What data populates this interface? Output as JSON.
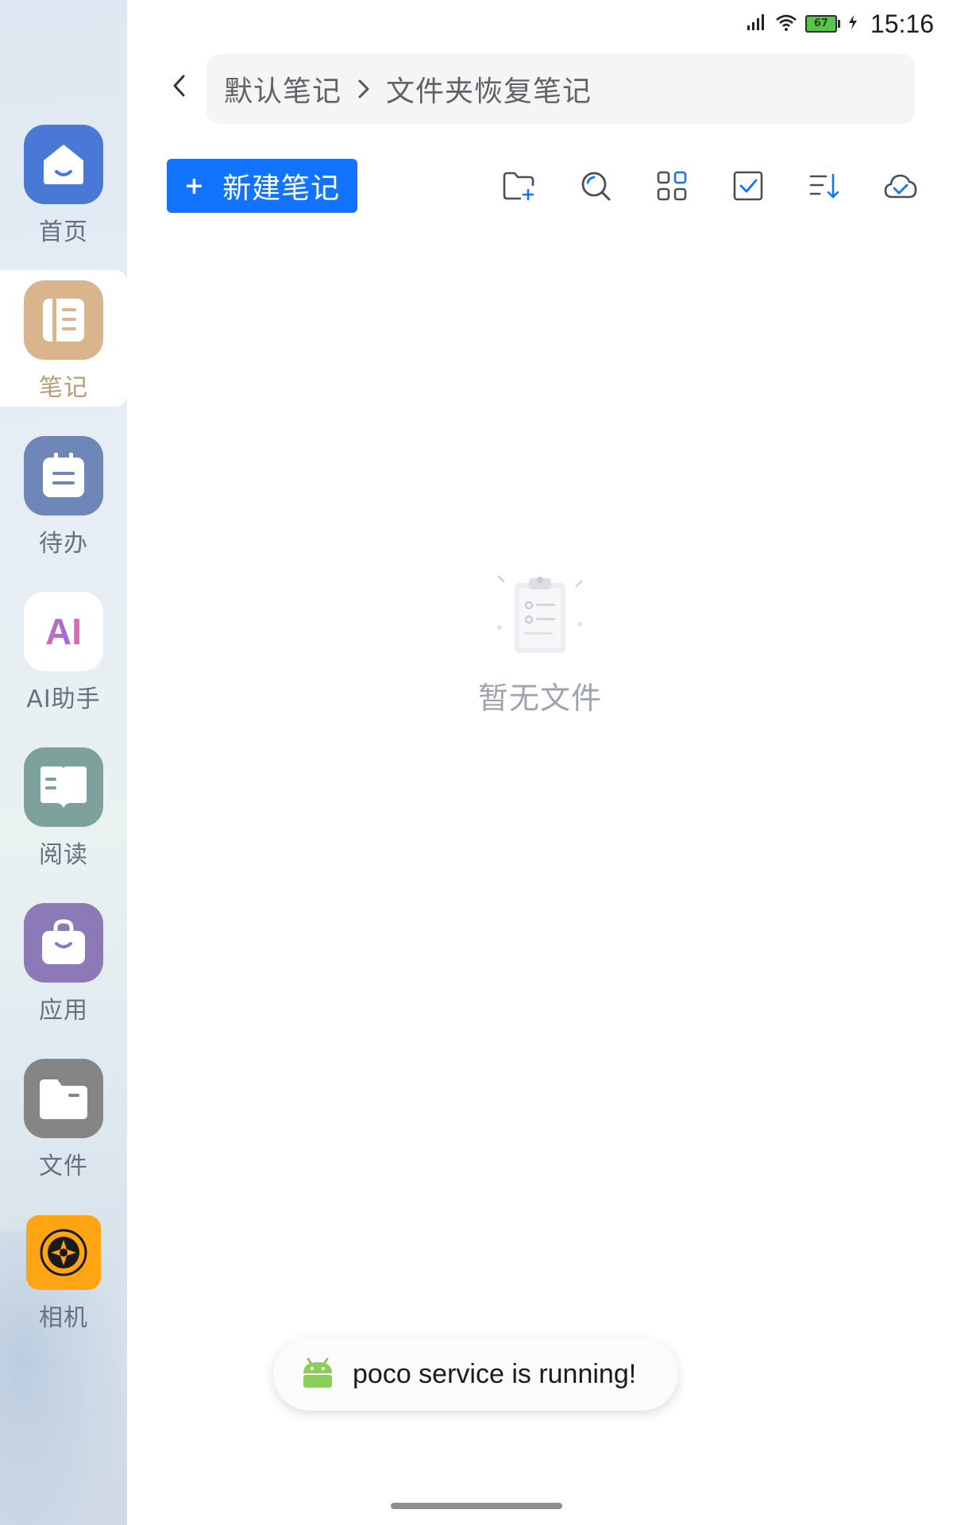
{
  "status_bar": {
    "battery_level": "67",
    "time": "15:16"
  },
  "sidebar": {
    "items": [
      {
        "label": "首页",
        "icon": "home-icon",
        "color": "#4a78d6"
      },
      {
        "label": "笔记",
        "icon": "notebook-icon",
        "color": "#d9b48c",
        "selected": true
      },
      {
        "label": "待办",
        "icon": "todo-icon",
        "color": "#6e87b8"
      },
      {
        "label": "AI助手",
        "icon": "ai-assistant-icon",
        "color": "#ffffff"
      },
      {
        "label": "阅读",
        "icon": "reading-icon",
        "color": "#7da19b"
      },
      {
        "label": "应用",
        "icon": "apps-bag-icon",
        "color": "#8c79b7"
      },
      {
        "label": "文件",
        "icon": "folder-icon",
        "color": "#858585"
      },
      {
        "label": "相机",
        "icon": "camera-icon",
        "color": "#ffa412"
      }
    ]
  },
  "breadcrumb": {
    "root": "默认笔记",
    "current": "文件夹恢复笔记"
  },
  "toolbar": {
    "new_note_plus": "+",
    "new_note_label": "新建笔记",
    "accent_color": "#1273ff"
  },
  "ai_icon_text": "AI",
  "empty_state": {
    "text": "暂无文件"
  },
  "toast": {
    "text": "poco service is running!"
  }
}
